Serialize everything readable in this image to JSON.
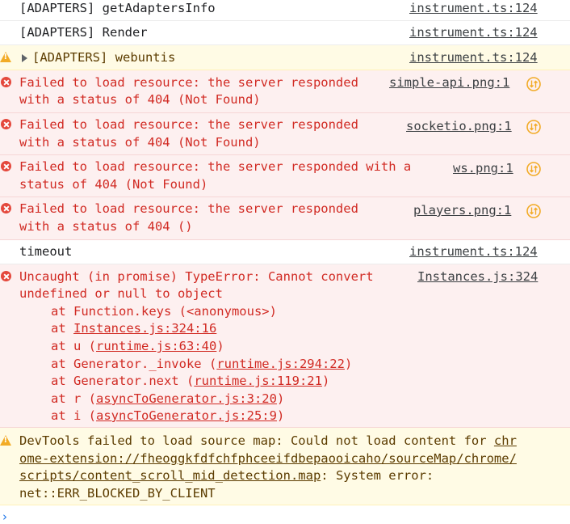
{
  "console": {
    "r1": {
      "text": "[ADAPTERS] getAdaptersInfo",
      "src": "instrument.ts:124"
    },
    "r2": {
      "text": "[ADAPTERS] Render",
      "src": "instrument.ts:124"
    },
    "r3": {
      "text": "[ADAPTERS] webuntis",
      "src": "instrument.ts:124"
    },
    "r4": {
      "l1": "Failed to load resource: the server responded",
      "l2": "with a status of 404 (Not Found)",
      "src": "simple-api.png:1"
    },
    "r5": {
      "l1": "Failed to load resource: the server responded",
      "l2": "with a status of 404 (Not Found)",
      "src": "socketio.png:1"
    },
    "r6": {
      "l1": "Failed to load resource: the server responded with a",
      "l2": "status of 404 (Not Found)",
      "src": "ws.png:1"
    },
    "r7": {
      "l1": "Failed to load resource: the server responded",
      "l2": "with a status of 404 ()",
      "src": "players.png:1"
    },
    "r8": {
      "text": "timeout",
      "src": "instrument.ts:124"
    },
    "r9": {
      "l1": "Uncaught (in promise) TypeError: Cannot convert",
      "l2": "undefined or null to object",
      "src": "Instances.js:324",
      "s1": "at Function.keys (<anonymous>)",
      "s2a": "at ",
      "s2b": "Instances.js:324:16",
      "s3a": "at u (",
      "s3b": "runtime.js:63:40",
      "s3c": ")",
      "s4a": "at Generator._invoke (",
      "s4b": "runtime.js:294:22",
      "s4c": ")",
      "s5a": "at Generator.next (",
      "s5b": "runtime.js:119:21",
      "s5c": ")",
      "s6a": "at r (",
      "s6b": "asyncToGenerator.js:3:20",
      "s6c": ")",
      "s7a": "at i (",
      "s7b": "asyncToGenerator.js:25:9",
      "s7c": ")"
    },
    "r10": {
      "l1a": "DevTools failed to load source map: Could not load content for ",
      "l1b": "chr",
      "l2": "ome-extension://fheoggkfdfchfphceeifdbepaooicaho/sourceMap/chrome/",
      "l3a": "scripts/content_scroll_mid_detection.map",
      "l3b": ": System error:",
      "l4": "net::ERR_BLOCKED_BY_CLIENT"
    },
    "prompt": "›"
  }
}
